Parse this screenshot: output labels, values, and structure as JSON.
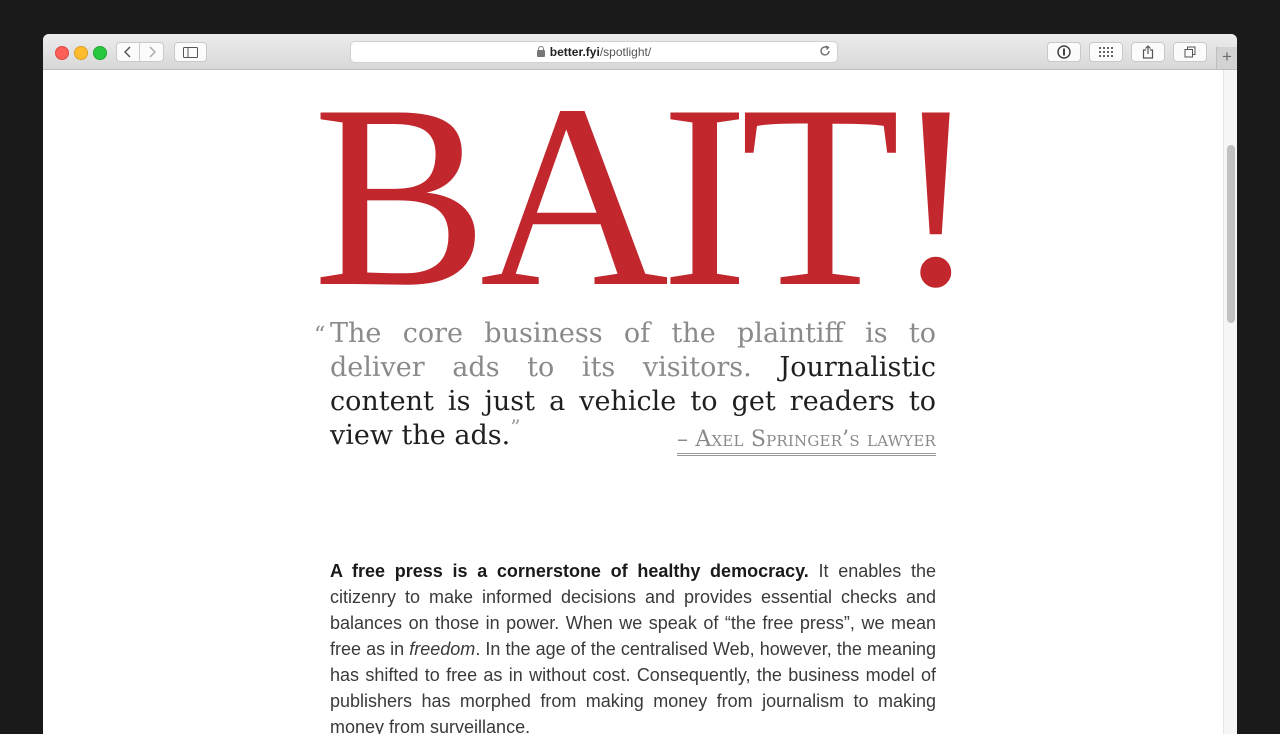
{
  "browser": {
    "url_domain": "better.fyi",
    "url_path": "/spotlight/",
    "new_tab_label": "+"
  },
  "page": {
    "headline": "BAIT!",
    "quote": {
      "open_mark": "“",
      "grey_text": "The core business of the plaintiff is to deliver ads to its visitors.",
      "dark_text": "Journalistic content is just a vehicle to get readers to view the ads.",
      "close_mark": "”",
      "attribution": "– Axel Springer’s lawyer"
    },
    "paragraph": {
      "lead": "A free press is a cornerstone of healthy democracy.",
      "text_1": "It enables the citizenry to make informed decisions and provides essential checks and balances on those in power. When we speak of “the free press”, we mean free as in",
      "emphasis": "freedom",
      "text_2": ". In the age of the centralised Web, however, the meaning has shifted to free as in without cost. Consequently, the business model of publishers has morphed from making money from journalism to making money from surveillance."
    }
  },
  "colors": {
    "headline": "#c1272d",
    "quote_grey": "#8a8a8a",
    "quote_dark": "#1f1f1f"
  },
  "icons": [
    "back-icon",
    "forward-icon",
    "sidebar-icon",
    "lock-icon",
    "reload-icon",
    "password-manager-icon",
    "grid-icon",
    "share-icon",
    "tabs-icon",
    "plus-icon"
  ]
}
